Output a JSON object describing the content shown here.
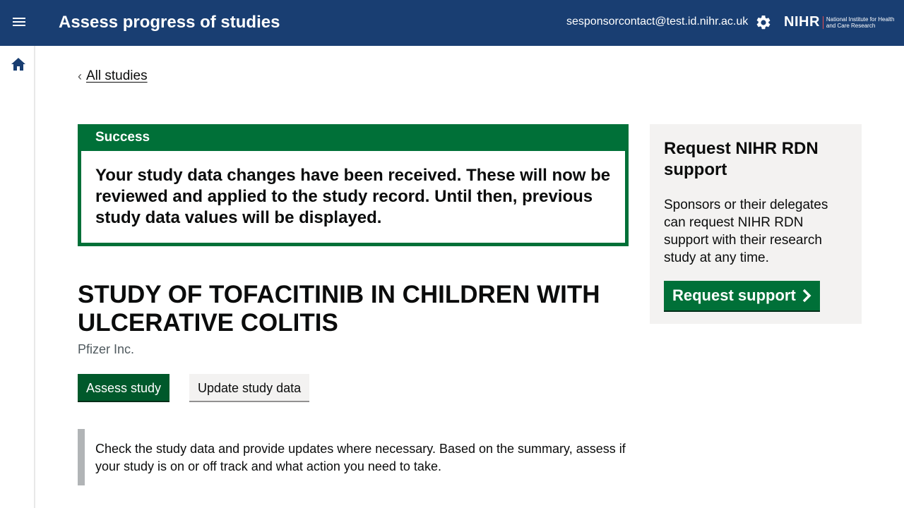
{
  "header": {
    "title": "Assess progress of studies",
    "user_email": "sesponsorcontact@test.id.nihr.ac.uk",
    "logo_main": "NIHR",
    "logo_sub": "National Institute for Health and Care Research"
  },
  "nav": {
    "back_label": "All studies"
  },
  "banner": {
    "title": "Success",
    "message": "Your study data changes have been received. These will now be reviewed and applied to the study record. Until then, previous study data values will be displayed."
  },
  "side_panel": {
    "title": "Request NIHR RDN support",
    "description": "Sponsors or their delegates can request NIHR RDN support with their research study at any time.",
    "button_label": "Request support"
  },
  "study": {
    "title": "STUDY OF TOFACITINIB IN CHILDREN WITH ULCERATIVE COLITIS",
    "sponsor": "Pfizer Inc.",
    "assess_label": "Assess study",
    "update_label": "Update study data",
    "guidance": "Check the study data and provide updates where necessary. Based on the summary, assess if your study is on or off track and what action you need to take."
  },
  "colors": {
    "header_bg": "#193e72",
    "success_green": "#007038",
    "primary_button": "#00592b",
    "panel_bg": "#f3f2f1"
  },
  "icons": [
    "menu-icon",
    "gear-icon",
    "home-icon",
    "chevron-left-icon",
    "chevron-right-icon"
  ]
}
